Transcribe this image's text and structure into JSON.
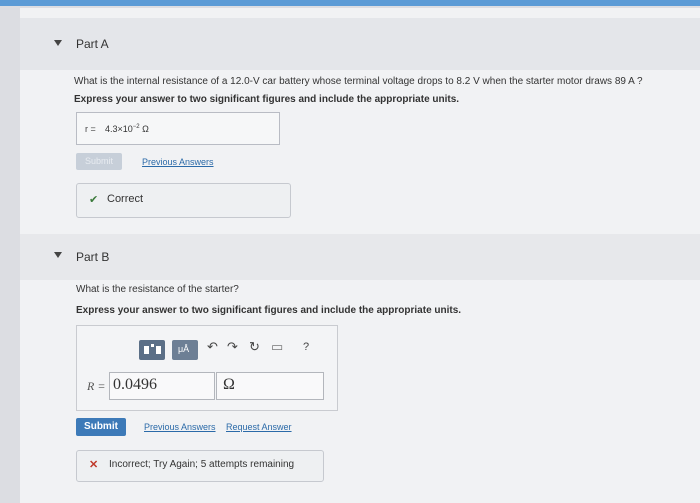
{
  "part_a": {
    "title": "Part A",
    "question": "What is the internal resistance of a 12.0-V car battery whose terminal voltage drops to 8.2  V when the starter motor draws 89  A ?",
    "instruction": "Express your answer to two significant figures and include the appropriate units.",
    "answer": {
      "label": "r =",
      "mantissa": "4.3×10",
      "exponent": "−2",
      "unit": "Ω"
    },
    "submit_label": "Submit",
    "previous_answers_label": "Previous Answers",
    "feedback": "Correct"
  },
  "part_b": {
    "title": "Part B",
    "question": "What is the resistance of the starter?",
    "instruction": "Express your answer to two significant figures and include the appropriate units.",
    "toolbar": {
      "units_label": "μÅ",
      "undo": "↶",
      "redo": "↷",
      "reset": "↻",
      "keyboard": "▭",
      "help": "?"
    },
    "answer_label": "R =",
    "answer_value": "0.0496",
    "answer_unit": "Ω",
    "submit_label": "Submit",
    "previous_answers_label": "Previous Answers",
    "request_answer_label": "Request Answer",
    "feedback": "Incorrect; Try Again; 5 attempts remaining"
  }
}
